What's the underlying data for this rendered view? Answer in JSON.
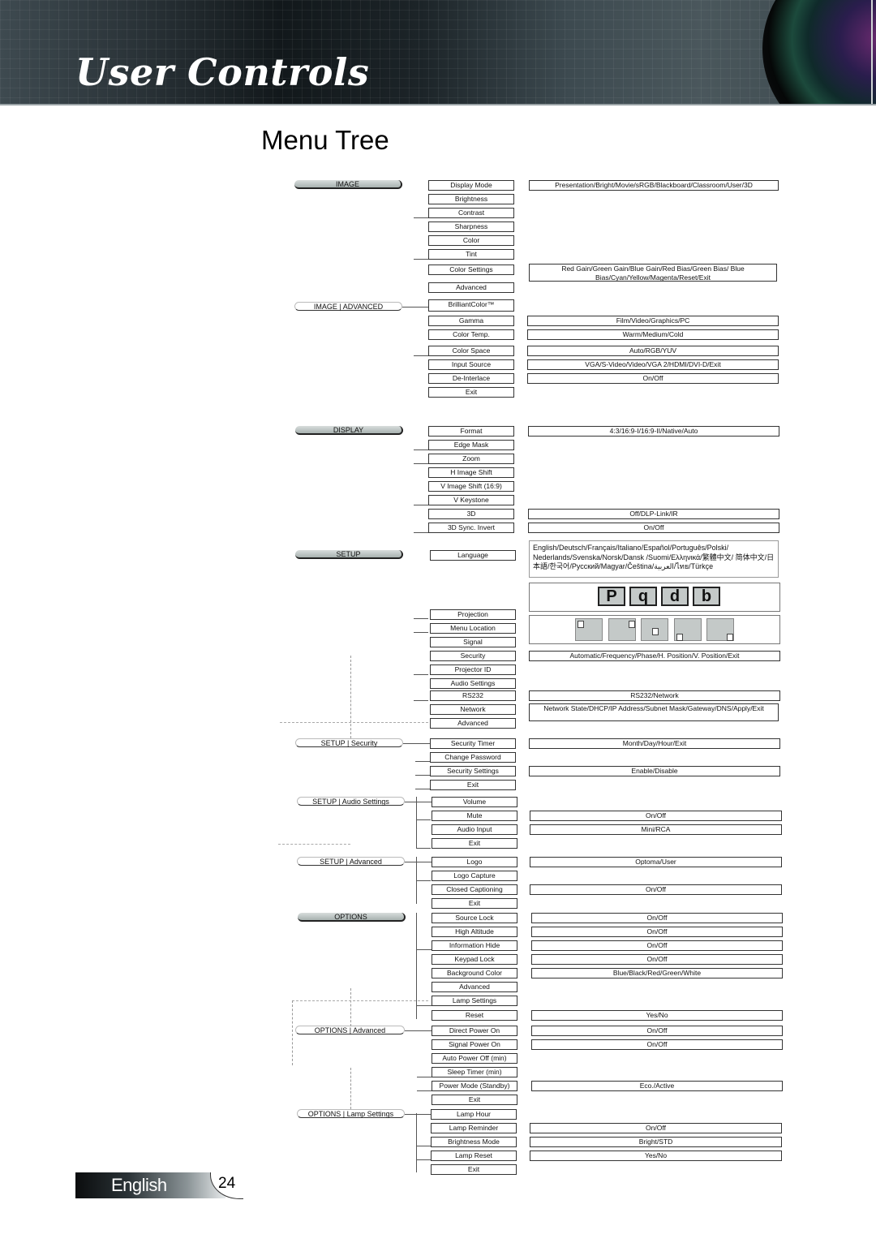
{
  "header": {
    "title": "User Controls"
  },
  "page_title": "Menu Tree",
  "footer": {
    "language": "English",
    "page_number": "24"
  },
  "sections": [
    {
      "category": "IMAGE",
      "kind": "main",
      "items": [
        {
          "label": "Display Mode",
          "options": "Presentation/Bright/Movie/sRGB/Blackboard/Classroom/User/3D"
        },
        {
          "label": "Brightness"
        },
        {
          "label": "Contrast"
        },
        {
          "label": "Sharpness"
        },
        {
          "label": "Color"
        },
        {
          "label": "Tint"
        },
        {
          "label": "Color Settings",
          "options": "Red Gain/Green Gain/Blue Gain/Red Bias/Green Bias/ Blue Bias/Cyan/Yellow/Magenta/Reset/Exit"
        },
        {
          "label": "Advanced"
        }
      ]
    },
    {
      "category": "IMAGE | ADVANCED",
      "kind": "sub",
      "items": [
        {
          "label": "BrilliantColor™"
        },
        {
          "label": "Gamma",
          "options": "Film/Video/Graphics/PC"
        },
        {
          "label": "Color Temp.",
          "options": "Warm/Medium/Cold"
        },
        {
          "label": "Color Space",
          "options": "Auto/RGB/YUV"
        },
        {
          "label": "Input Source",
          "options": "VGA/S-Video/Video/VGA 2/HDMI/DVI-D/Exit"
        },
        {
          "label": "De-Interlace",
          "options": "On/Off"
        },
        {
          "label": "Exit"
        }
      ]
    },
    {
      "category": "DISPLAY",
      "kind": "main",
      "items": [
        {
          "label": "Format",
          "options": "4:3/16:9-I/16:9-II/Native/Auto"
        },
        {
          "label": "Edge Mask"
        },
        {
          "label": "Zoom"
        },
        {
          "label": "H Image Shift"
        },
        {
          "label": "V Image Shift (16:9)"
        },
        {
          "label": "V Keystone"
        },
        {
          "label": "3D",
          "options": "Off/DLP-Link/IR"
        },
        {
          "label": "3D Sync. Invert",
          "options": "On/Off"
        }
      ]
    },
    {
      "category": "SETUP",
      "kind": "main",
      "items": [
        {
          "label": "Language",
          "options": "English/Deutsch/Français/Italiano/Español/Português/Polski/ Nederlands/Svenska/Norsk/Dansk /Suomi/Ελληνικά/繁體中文/ 简体中文/日本語/한국어/Русский/Magyar/Čeština/العربية/ไทย/Türkçe"
        },
        {
          "label": "Projection",
          "options_icons": [
            "P",
            "q",
            "d",
            "b"
          ]
        },
        {
          "label": "Menu Location",
          "options_icons": [
            "top-left",
            "top-right",
            "center",
            "bottom-left",
            "bottom-right"
          ]
        },
        {
          "label": "Signal"
        },
        {
          "label": "Security",
          "options": "Automatic/Frequency/Phase/H. Position/V. Position/Exit"
        },
        {
          "label": "Projector ID"
        },
        {
          "label": "Audio Settings"
        },
        {
          "label": "RS232",
          "options": "RS232/Network"
        },
        {
          "label": "Network",
          "options": "Network State/DHCP/IP Address/Subnet Mask/Gateway/DNS/Apply/Exit"
        },
        {
          "label": "Advanced"
        }
      ]
    },
    {
      "category": "SETUP | Security",
      "kind": "sub",
      "items": [
        {
          "label": "Security Timer",
          "options": "Month/Day/Hour/Exit"
        },
        {
          "label": "Change Password"
        },
        {
          "label": "Security Settings",
          "options": "Enable/Disable"
        },
        {
          "label": "Exit"
        }
      ]
    },
    {
      "category": "SETUP | Audio Settings",
      "kind": "sub",
      "items": [
        {
          "label": "Volume"
        },
        {
          "label": "Mute",
          "options": "On/Off"
        },
        {
          "label": "Audio Input",
          "options": "Mini/RCA"
        },
        {
          "label": "Exit"
        }
      ]
    },
    {
      "category": "SETUP | Advanced",
      "kind": "sub",
      "items": [
        {
          "label": "Logo",
          "options": "Optoma/User"
        },
        {
          "label": "Logo Capture"
        },
        {
          "label": "Closed Captioning",
          "options": "On/Off"
        },
        {
          "label": "Exit"
        }
      ]
    },
    {
      "category": "OPTIONS",
      "kind": "main",
      "items": [
        {
          "label": "Source Lock",
          "options": "On/Off"
        },
        {
          "label": "High Altitude",
          "options": "On/Off"
        },
        {
          "label": "Information Hide",
          "options": "On/Off"
        },
        {
          "label": "Keypad Lock",
          "options": "On/Off"
        },
        {
          "label": "Background Color",
          "options": "Blue/Black/Red/Green/White"
        },
        {
          "label": "Advanced"
        },
        {
          "label": "Lamp Settings"
        },
        {
          "label": "Reset",
          "options": "Yes/No"
        }
      ]
    },
    {
      "category": "OPTIONS | Advanced",
      "kind": "sub",
      "items": [
        {
          "label": "Direct Power On",
          "options": "On/Off"
        },
        {
          "label": "Signal Power On",
          "options": "On/Off"
        },
        {
          "label": "Auto Power Off (min)"
        },
        {
          "label": "Sleep Timer (min)"
        },
        {
          "label": "Power Mode (Standby)",
          "options": "Eco./Active"
        },
        {
          "label": "Exit"
        }
      ]
    },
    {
      "category": "OPTIONS | Lamp Settings",
      "kind": "sub",
      "items": [
        {
          "label": "Lamp Hour"
        },
        {
          "label": "Lamp Reminder",
          "options": "On/Off"
        },
        {
          "label": "Brightness Mode",
          "options": "Bright/STD"
        },
        {
          "label": "Lamp Reset",
          "options": "Yes/No"
        },
        {
          "label": "Exit"
        }
      ]
    }
  ]
}
